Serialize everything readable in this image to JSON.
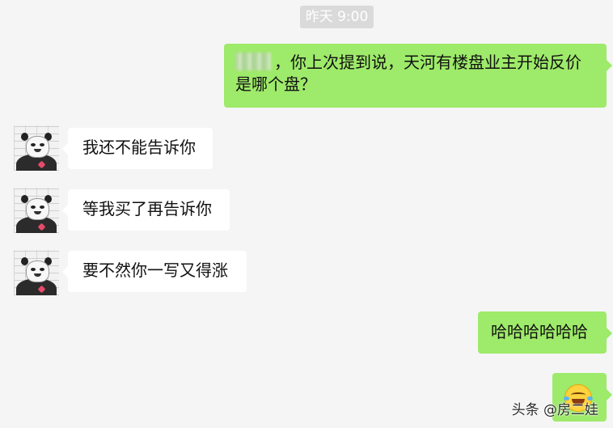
{
  "chat": {
    "timestamp": "昨天 9:00",
    "messages": [
      {
        "side": "out",
        "text": "，你上次提到说，天河有楼盘业主开始反价",
        "text_line2": "是哪个盘？",
        "redacted_prefix": true
      },
      {
        "side": "in",
        "text": "我还不能告诉你"
      },
      {
        "side": "in",
        "text": "等我买了再告诉你"
      },
      {
        "side": "in",
        "text": "要不然你一写又得涨"
      },
      {
        "side": "out",
        "text": "哈哈哈哈哈哈"
      },
      {
        "side": "out",
        "emoji": "tears-of-joy-emoji"
      }
    ]
  },
  "watermark": "头条 @房二娃",
  "colors": {
    "outgoing_bubble": "#9eea6a",
    "incoming_bubble": "#ffffff",
    "background": "#f5f5f5"
  }
}
